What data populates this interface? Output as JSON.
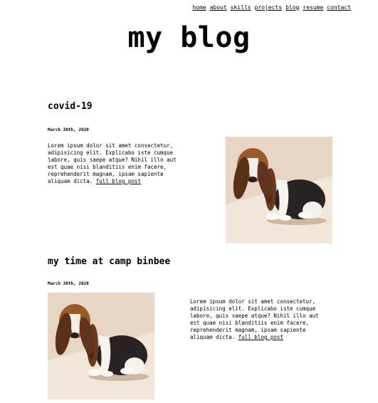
{
  "nav": {
    "items": [
      "home",
      "about",
      "skills",
      "projects",
      "blog",
      "resume",
      "contact"
    ]
  },
  "site": {
    "title": "my blog"
  },
  "posts": [
    {
      "title": "covid-19",
      "date": "March 30th, 2020",
      "excerpt": "Lorem ipsum dolor sit amet consectetur, adipisicing elit. Explicabo iste cumque labore, quis saepe atque? Nihil illo aut est quae nisi blanditiis enim facere, reprehenderit magnam, ipsam sapiente aliquam dicta.",
      "link": "full blog post",
      "image": "puppy-photo"
    },
    {
      "title": "my time at camp binbee",
      "date": "March 30th, 2020",
      "excerpt": "Lorem ipsum dolor sit amet consectetur, adipisicing elit. Explicabo iste cumque labore, quis saepe atque? Nihil illo aut est quae nisi blanditiis enim facere, reprehenderit magnam, ipsam sapiente aliquam dicta.",
      "link": "full blog post",
      "image": "puppy-photo"
    }
  ]
}
